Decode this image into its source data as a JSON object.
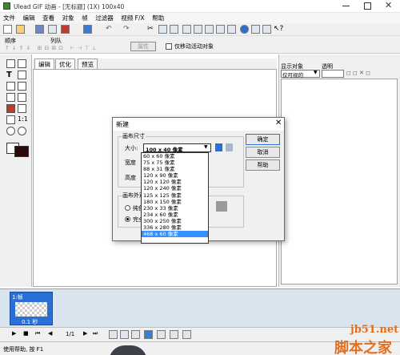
{
  "window": {
    "title": "Ulead GIF 动画 - [无标题] (1X) 100x40"
  },
  "menu": [
    "文件",
    "编辑",
    "查看",
    "对象",
    "帧",
    "过滤器",
    "视频 F/X",
    "帮助"
  ],
  "toolbar2": {
    "order_label": "顺序",
    "queue_label": "列队",
    "attr_button": "属性",
    "move_active_label": "仅移动活动对象"
  },
  "tabs": [
    "编辑",
    "优化",
    "预览"
  ],
  "right_panel": {
    "show_object_label": "显示对象",
    "opacity_label": "透明",
    "visibility_value": "仅可视的"
  },
  "dialog": {
    "title": "新建",
    "canvas_size_group": "画布尺寸",
    "size_label": "大小:",
    "size_value": "100 x 40 像素",
    "width_label": "宽度",
    "height_label": "高度",
    "appearance_group": "画布外观",
    "radio1": "纯色",
    "radio2": "完全",
    "ok_button": "确定",
    "cancel_button": "取消",
    "help_button": "帮助"
  },
  "size_options": [
    "60 x 60 像素",
    "75 x 75 像素",
    "88 x 31 像素",
    "120 x 90 像素",
    "120 x 120 像素",
    "120 x 240 像素",
    "125 x 125 像素",
    "180 x 150 像素",
    "230 x 33 像素",
    "234 x 60 像素",
    "300 x 250 像素",
    "336 x 280 像素",
    "468 x 60 像素"
  ],
  "selected_option_index": 12,
  "frame": {
    "label": "1:帧",
    "duration": "0.1 秒"
  },
  "controls": {
    "frame_counter": "1/1"
  },
  "status": {
    "text": "使用帮助, 按 F1"
  },
  "watermark": {
    "site": "jb51.net",
    "brand": "脚本之家"
  },
  "colors": {
    "selection": "#3390ff",
    "frame_strip": "#d8e4ee"
  }
}
